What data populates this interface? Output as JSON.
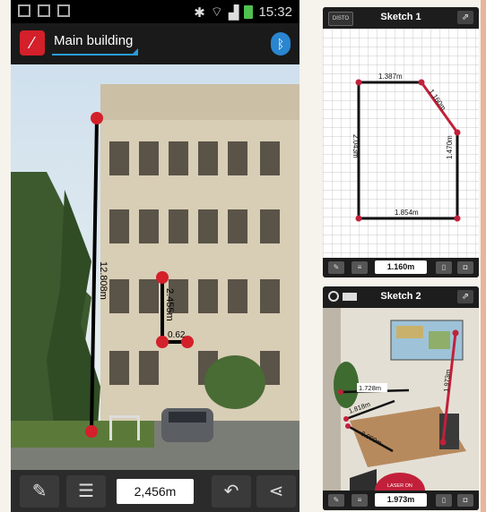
{
  "status_bar": {
    "time": "15:32"
  },
  "main_app": {
    "title": "Main building",
    "measurements": {
      "height_long": "12.808m",
      "height_short": "2.455m",
      "width_small": "0.62"
    },
    "bottom_value": "2,456m"
  },
  "sketch1": {
    "disto_label": "DISTO",
    "title": "Sketch 1",
    "dims": {
      "top": "1.387m",
      "diag": "1.160m",
      "left": "2.043m",
      "right": "1.470m",
      "bottom": "1.854m"
    },
    "footer_value": "1.160m"
  },
  "sketch2": {
    "title": "Sketch 2",
    "dims": {
      "d1": "1.728m",
      "d2": "1.818m",
      "d3": "0.900m",
      "d4": "1.973m"
    },
    "laser_label": "LASER ON",
    "footer_value": "1.973m"
  },
  "colors": {
    "accent_red": "#d3202a",
    "bluetooth": "#2a86d0"
  }
}
